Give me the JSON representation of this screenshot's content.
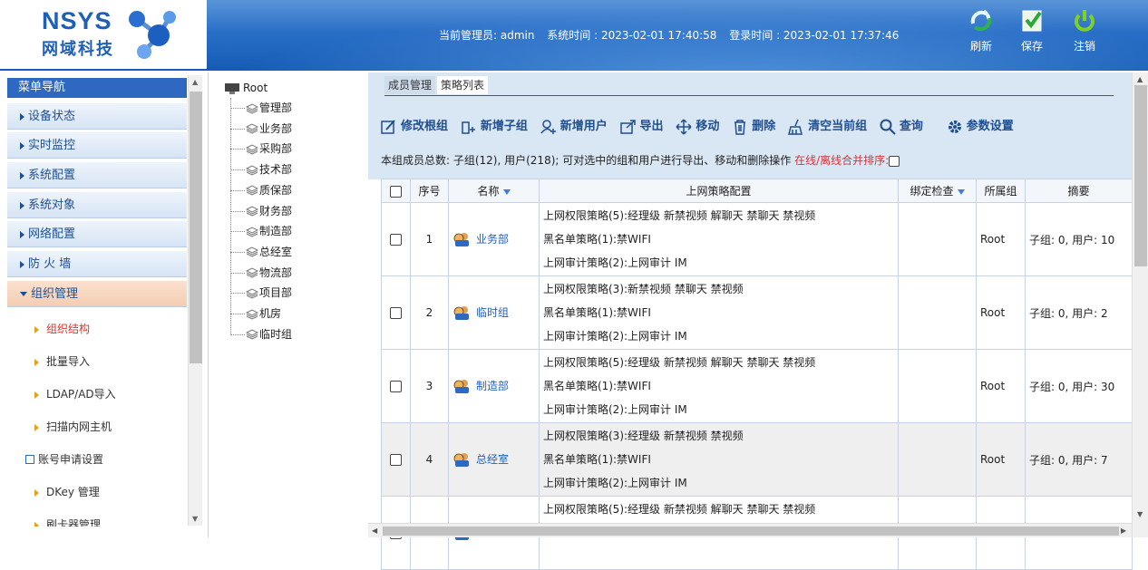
{
  "header": {
    "logo_title": "NSYS",
    "logo_subtitle": "网域科技",
    "admin_label": "当前管理员: admin",
    "system_time": "系统时间 : 2023-02-01 17:40:58",
    "login_time": "登录时间 : 2023-02-01 17:37:46",
    "buttons": {
      "refresh": "刷新",
      "save": "保存",
      "logout": "注销"
    }
  },
  "sidebar": {
    "title": "菜单导航",
    "menus": [
      {
        "label": "设备状态"
      },
      {
        "label": "实时监控"
      },
      {
        "label": "系统配置"
      },
      {
        "label": "系统对象"
      },
      {
        "label": "网络配置"
      },
      {
        "label": "防 火 墙"
      },
      {
        "label": "组织管理"
      }
    ],
    "submenu": [
      {
        "label": "组织结构"
      },
      {
        "label": "批量导入"
      },
      {
        "label": "LDAP/AD导入"
      },
      {
        "label": "扫描内网主机"
      },
      {
        "label": "账号申请设置"
      },
      {
        "label": "DKey 管理"
      },
      {
        "label": "刷卡器管理"
      }
    ]
  },
  "tree": {
    "root": "Root",
    "nodes": [
      "管理部",
      "业务部",
      "采购部",
      "技术部",
      "质保部",
      "财务部",
      "制造部",
      "总经室",
      "物流部",
      "项目部",
      "机房",
      "临时组"
    ]
  },
  "main": {
    "tabs": [
      "成员管理",
      "策略列表"
    ],
    "toolbar": {
      "edit_root": "修改根组",
      "add_subgroup": "新增子组",
      "add_user": "新增用户",
      "export": "导出",
      "move": "移动",
      "delete": "删除",
      "clear_group": "清空当前组",
      "query": "查询",
      "params": "参数设置"
    },
    "summary": "本组成员总数: 子组(12), 用户(218); 可对选中的组和用户进行导出、移动和删除操作",
    "summary_red": "在线/离线合并排序:",
    "columns": {
      "index": "序号",
      "name": "名称",
      "policy": "上网策略配置",
      "binding": "绑定检查",
      "group": "所属组",
      "summary": "摘要"
    },
    "rows": [
      {
        "index": "1",
        "name": "业务部",
        "p1": "上网权限策略(5):经理级 新禁视频 解聊天 禁聊天 禁视频",
        "p2": "黑名单策略(1):禁WIFI",
        "p3": "上网审计策略(2):上网审计 IM",
        "group": "Root",
        "summary": "子组: 0, 用户: 10"
      },
      {
        "index": "2",
        "name": "临时组",
        "p1": "上网权限策略(3):新禁视频 禁聊天 禁视频",
        "p2": "黑名单策略(1):禁WIFI",
        "p3": "上网审计策略(2):上网审计 IM",
        "group": "Root",
        "summary": "子组: 0, 用户: 2"
      },
      {
        "index": "3",
        "name": "制造部",
        "p1": "上网权限策略(5):经理级 新禁视频 解聊天 禁聊天 禁视频",
        "p2": "黑名单策略(1):禁WIFI",
        "p3": "上网审计策略(2):上网审计 IM",
        "group": "Root",
        "summary": "子组: 0, 用户: 30"
      },
      {
        "index": "4",
        "name": "总经室",
        "p1": "上网权限策略(3):经理级 新禁视频 禁视频",
        "p2": "黑名单策略(1):禁WIFI",
        "p3": "上网审计策略(2):上网审计 IM",
        "group": "Root",
        "summary": "子组: 0, 用户: 7"
      },
      {
        "index": "",
        "name": "",
        "p1": "上网权限策略(5):经理级 新禁视频 解聊天 禁聊天 禁视频",
        "p2": "",
        "p3": "",
        "group": "",
        "summary": ""
      }
    ]
  }
}
